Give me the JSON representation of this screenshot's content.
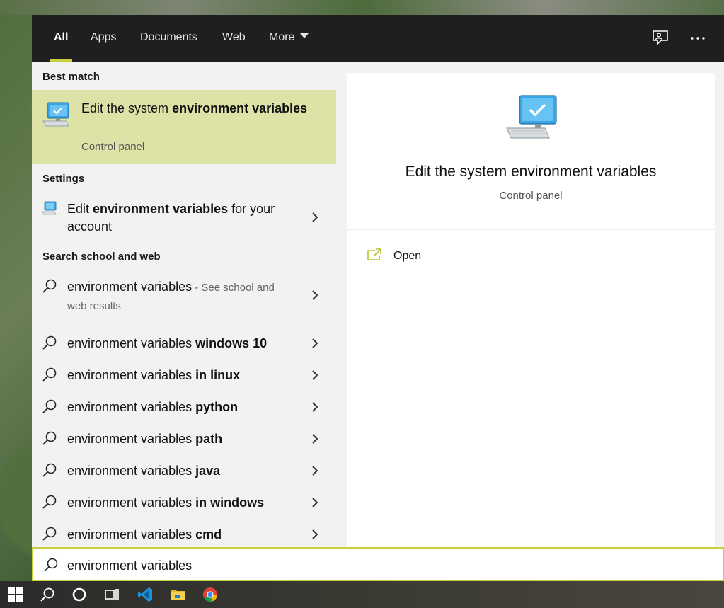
{
  "tabs": [
    {
      "label": "All",
      "active": true
    },
    {
      "label": "Apps"
    },
    {
      "label": "Documents"
    },
    {
      "label": "Web"
    },
    {
      "label": "More"
    }
  ],
  "topbar_icons": [
    "feedback-icon",
    "more-options-icon"
  ],
  "best_match": {
    "heading": "Best match",
    "title_plain": "Edit the system ",
    "title_bold": "environment variables",
    "subtitle": "Control panel",
    "icon": "computer-check-icon"
  },
  "settings": {
    "heading": "Settings",
    "item": {
      "pre": "Edit ",
      "bold": "environment variables",
      "post": " for your account",
      "icon": "settings-computer-icon"
    }
  },
  "web": {
    "heading": "Search school and web",
    "first": {
      "query": "environment variables",
      "hint": " - See school and web results"
    },
    "suggestions": [
      {
        "base": "environment variables ",
        "bold": "windows 10"
      },
      {
        "base": "environment variables ",
        "bold": "in linux"
      },
      {
        "base": "environment variables ",
        "bold": "python"
      },
      {
        "base": "environment variables ",
        "bold": "path"
      },
      {
        "base": "environment variables ",
        "bold": "java"
      },
      {
        "base": "environment variables ",
        "bold": "in windows"
      },
      {
        "base": "environment variables ",
        "bold": "cmd"
      }
    ]
  },
  "preview": {
    "title": "Edit the system environment variables",
    "subtitle": "Control panel",
    "action_label": "Open"
  },
  "search": {
    "value": "environment variables"
  },
  "taskbar": [
    "start-icon",
    "search-icon",
    "cortana-icon",
    "task-view-icon",
    "vscode-icon",
    "file-explorer-icon",
    "chrome-icon"
  ],
  "colors": {
    "accent": "#c7cf3b",
    "best_match_bg": "#dde3a7",
    "topbar_bg": "#1f1f1f"
  }
}
